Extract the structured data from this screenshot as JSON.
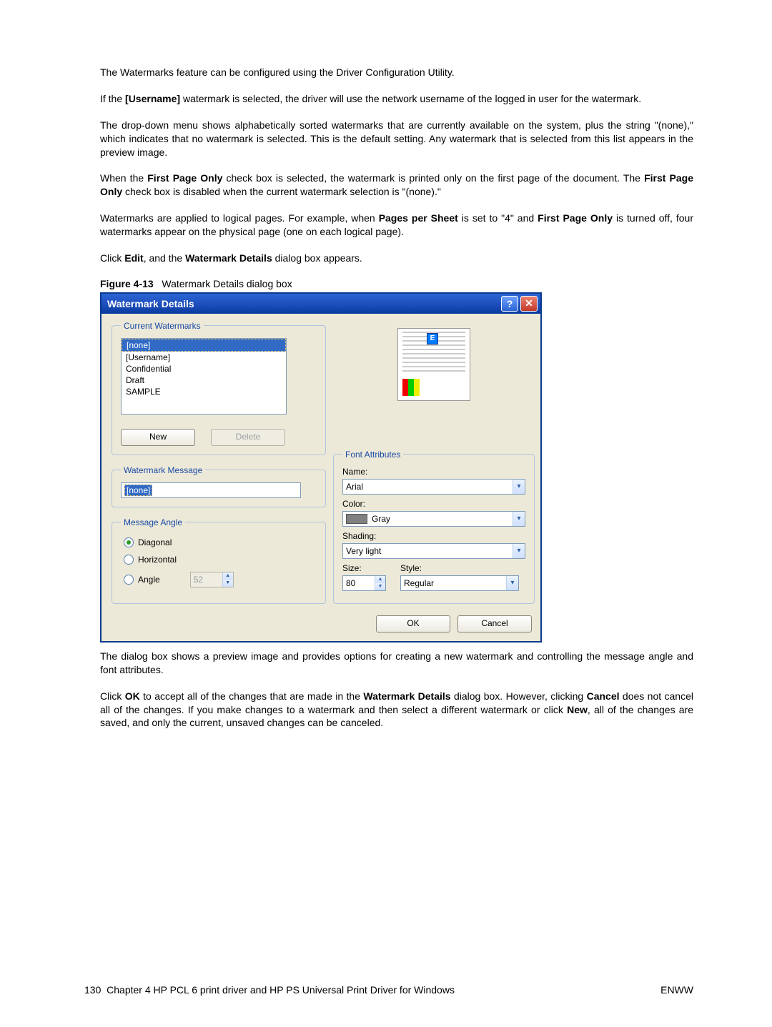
{
  "paragraphs": {
    "p1": "The Watermarks feature can be configured using the Driver Configuration Utility.",
    "p2a": "If the ",
    "p2b": "[Username]",
    "p2c": " watermark is selected, the driver will use the network username of the logged in user for the watermark.",
    "p3": "The drop-down menu shows alphabetically sorted watermarks that are currently available on the system, plus the string \"(none),\" which indicates that no watermark is selected. This is the default setting. Any watermark that is selected from this list appears in the preview image.",
    "p4a": "When the ",
    "p4b": "First Page Only",
    "p4c": " check box is selected, the watermark is printed only on the first page of the document. The ",
    "p4d": "First Page Only",
    "p4e": " check box is disabled when the current watermark selection is \"(none).\"",
    "p5a": "Watermarks are applied to logical pages. For example, when ",
    "p5b": "Pages per Sheet",
    "p5c": " is set to \"4\" and ",
    "p5d": "First Page Only",
    "p5e": " is turned off, four watermarks appear on the physical page (one on each logical page).",
    "p6a": "Click ",
    "p6b": "Edit",
    "p6c": ", and the ",
    "p6d": "Watermark Details",
    "p6e": " dialog box appears.",
    "p7": "The dialog box shows a preview image and provides options for creating a new watermark and controlling the message angle and font attributes.",
    "p8a": "Click ",
    "p8b": "OK",
    "p8c": " to accept all of the changes that are made in the ",
    "p8d": "Watermark Details",
    "p8e": " dialog box. However, clicking ",
    "p8f": "Cancel",
    "p8g": " does not cancel all of the changes. If you make changes to a watermark and then select a different watermark or click ",
    "p8h": "New",
    "p8i": ", all of the changes are saved, and only the current, unsaved changes can be canceled."
  },
  "figure": {
    "label": "Figure 4-13",
    "caption": "Watermark Details dialog box"
  },
  "dialog": {
    "title": "Watermark Details",
    "current_watermarks": {
      "legend": "Current Watermarks",
      "items": [
        "[none]",
        "[Username]",
        "Confidential",
        "Draft",
        "SAMPLE"
      ],
      "selected_index": 0,
      "new_btn": "New",
      "delete_btn": "Delete"
    },
    "watermark_message": {
      "legend": "Watermark Message",
      "value": "[none]"
    },
    "message_angle": {
      "legend": "Message Angle",
      "diagonal": "Diagonal",
      "horizontal": "Horizontal",
      "angle": "Angle",
      "angle_value": "52"
    },
    "font_attributes": {
      "legend": "Font Attributes",
      "name_label": "Name:",
      "name_value": "Arial",
      "color_label": "Color:",
      "color_value": "Gray",
      "shading_label": "Shading:",
      "shading_value": "Very light",
      "size_label": "Size:",
      "size_value": "80",
      "style_label": "Style:",
      "style_value": "Regular"
    },
    "ok": "OK",
    "cancel": "Cancel"
  },
  "footer": {
    "page": "130",
    "chapter": "Chapter 4   HP PCL 6 print driver and HP PS Universal Print Driver for Windows",
    "right": "ENWW"
  }
}
